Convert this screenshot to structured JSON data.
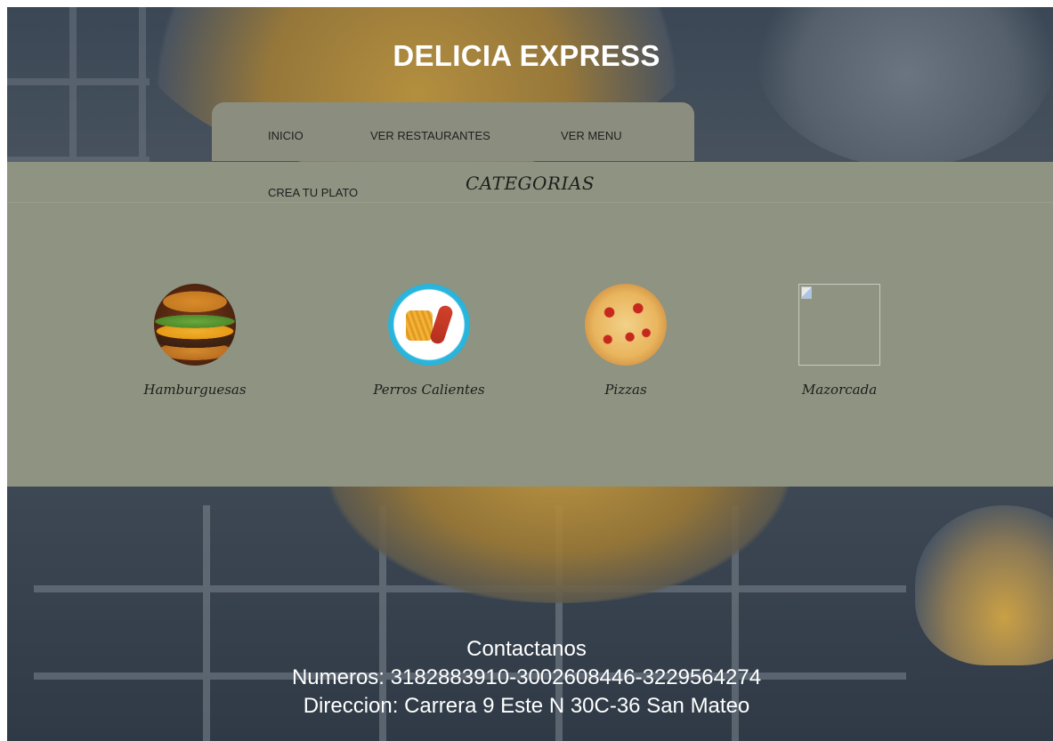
{
  "header": {
    "title": "DELICIA EXPRESS"
  },
  "nav": {
    "items": [
      {
        "label": "INICIO"
      },
      {
        "label": "VER RESTAURANTES"
      },
      {
        "label": "VER MENU"
      },
      {
        "label": "CREA TU PLATO"
      }
    ]
  },
  "categories": {
    "title": "CATEGORIAS",
    "items": [
      {
        "label": "Hamburguesas",
        "icon": "burger-image"
      },
      {
        "label": "Perros Calientes",
        "icon": "hotdog-image"
      },
      {
        "label": "Pizzas",
        "icon": "pizza-image"
      },
      {
        "label": "Mazorcada",
        "icon": "broken-image"
      }
    ]
  },
  "contact": {
    "heading": "Contactanos",
    "numbers": "Numeros: 3182883910-3002608446-3229564274",
    "address": "Direccion: Carrera 9 Este N 30C-36 San Mateo"
  },
  "colors": {
    "panel": "#8f9381",
    "nav_panel": "#8b8e7f",
    "text_light": "#ffffff",
    "text_dark": "#1d1d1d"
  }
}
